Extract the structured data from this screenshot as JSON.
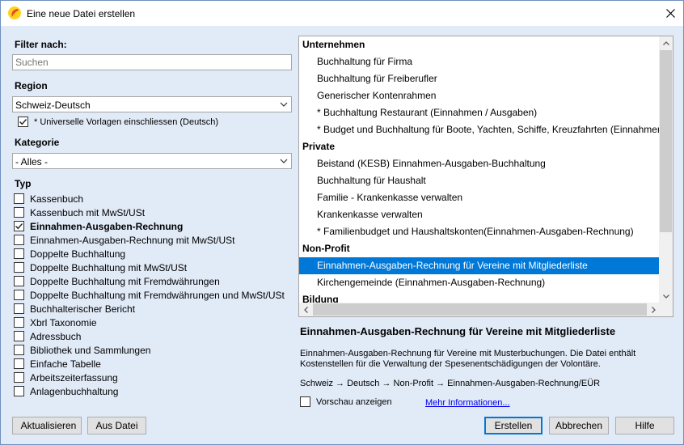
{
  "window": {
    "title": "Eine neue Datei erstellen"
  },
  "filter": {
    "label": "Filter nach:",
    "search_placeholder": "Suchen"
  },
  "region": {
    "label": "Region",
    "selected": "Schweiz-Deutsch",
    "universal_label": "* Universelle Vorlagen einschliessen (Deutsch)",
    "universal_checked": true
  },
  "category": {
    "label": "Kategorie",
    "selected": "- Alles -"
  },
  "type": {
    "label": "Typ",
    "items": [
      {
        "label": "Kassenbuch",
        "checked": false
      },
      {
        "label": "Kassenbuch mit MwSt/USt",
        "checked": false
      },
      {
        "label": "Einnahmen-Ausgaben-Rechnung",
        "checked": true
      },
      {
        "label": "Einnahmen-Ausgaben-Rechnung mit MwSt/USt",
        "checked": false
      },
      {
        "label": "Doppelte Buchhaltung",
        "checked": false
      },
      {
        "label": "Doppelte Buchhaltung mit MwSt/USt",
        "checked": false
      },
      {
        "label": "Doppelte Buchhaltung mit Fremdwährungen",
        "checked": false
      },
      {
        "label": "Doppelte Buchhaltung mit Fremdwährungen und MwSt/USt",
        "checked": false
      },
      {
        "label": "Buchhalterischer Bericht",
        "checked": false
      },
      {
        "label": "Xbrl Taxonomie",
        "checked": false
      },
      {
        "label": "Adressbuch",
        "checked": false
      },
      {
        "label": "Bibliothek und Sammlungen",
        "checked": false
      },
      {
        "label": "Einfache Tabelle",
        "checked": false
      },
      {
        "label": "Arbeitszeiterfassung",
        "checked": false
      },
      {
        "label": "Anlagenbuchhaltung",
        "checked": false
      }
    ]
  },
  "templates": [
    {
      "kind": "group",
      "label": "Unternehmen"
    },
    {
      "kind": "item",
      "label": "Buchhaltung für Firma"
    },
    {
      "kind": "item",
      "label": "Buchhaltung für Freiberufler"
    },
    {
      "kind": "item",
      "label": "Generischer Kontenrahmen"
    },
    {
      "kind": "item",
      "label": "* Buchhaltung Restaurant (Einnahmen / Ausgaben)"
    },
    {
      "kind": "item",
      "label": "* Budget und Buchhaltung für Boote, Yachten, Schiffe, Kreuzfahrten (Einnahmen"
    },
    {
      "kind": "group",
      "label": "Private"
    },
    {
      "kind": "item",
      "label": "Beistand (KESB) Einnahmen-Ausgaben-Buchhaltung"
    },
    {
      "kind": "item",
      "label": "Buchhaltung für Haushalt"
    },
    {
      "kind": "item",
      "label": "Familie - Krankenkasse verwalten"
    },
    {
      "kind": "item",
      "label": "Krankenkasse verwalten"
    },
    {
      "kind": "item",
      "label": "* Familienbudget und Haushaltskonten(Einnahmen-Ausgaben-Rechnung)"
    },
    {
      "kind": "group",
      "label": "Non-Profit"
    },
    {
      "kind": "item",
      "label": "Einnahmen-Ausgaben-Rechnung für Vereine mit Mitgliederliste",
      "selected": true
    },
    {
      "kind": "item",
      "label": "Kirchengemeinde (Einnahmen-Ausgaben-Rechnung)"
    },
    {
      "kind": "group",
      "label": "Bildung"
    }
  ],
  "details": {
    "title": "Einnahmen-Ausgaben-Rechnung für Vereine mit Mitgliederliste",
    "description": "Einnahmen-Ausgaben-Rechnung für Vereine mit Musterbuchungen. Die Datei enthält Kostenstellen für die Verwaltung der Spesenentschädigungen der Volontäre.",
    "path": "Schweiz → Deutsch → Non-Profit → Einnahmen-Ausgaben-Rechnung/EÜR",
    "preview_label": "Vorschau anzeigen",
    "more_info": "Mehr Informationen..."
  },
  "buttons": {
    "refresh": "Aktualisieren",
    "from_file": "Aus Datei",
    "create": "Erstellen",
    "cancel": "Abbrechen",
    "help": "Hilfe"
  },
  "colors": {
    "selection": "#0078d7",
    "background": "#e1eaf7",
    "app_icon": "#e8501e"
  }
}
